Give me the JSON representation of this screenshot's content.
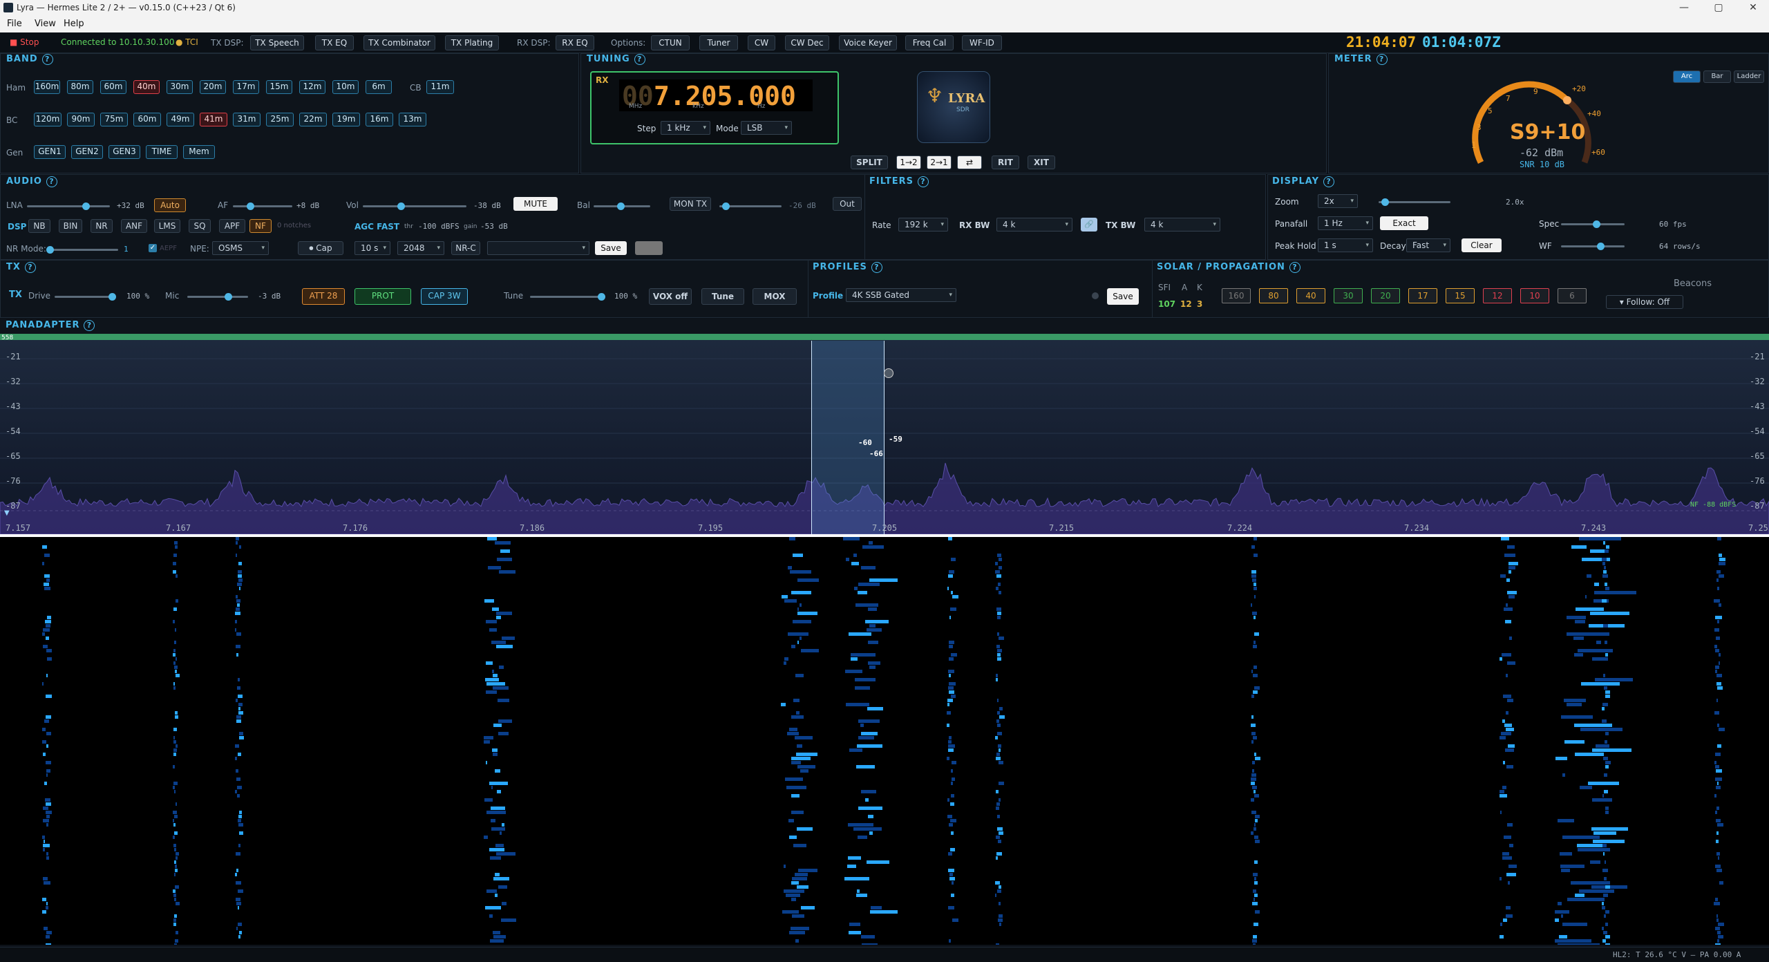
{
  "window": {
    "title": "Lyra — Hermes Lite 2 / 2+ — v0.15.0 (C++23 / Qt 6)",
    "minimize": "—",
    "maximize": "▢",
    "close": "✕"
  },
  "menu": [
    "File",
    "View",
    "Help"
  ],
  "toolbar": {
    "stop": "■ Stop",
    "connected": "Connected to 10.10.30.100",
    "tci": "● TCI",
    "tx_dsp_label": "TX DSP:",
    "tx_buttons": [
      "TX Speech",
      "TX EQ",
      "TX Combinator",
      "TX Plating"
    ],
    "rx_dsp_label": "RX DSP:",
    "rx_eq": "RX EQ",
    "options_label": "Options:",
    "option_buttons": [
      "CTUN",
      "Tuner",
      "CW",
      "CW Dec",
      "Voice Keyer",
      "Freq Cal",
      "WF-ID"
    ],
    "local_time": "21:04:07",
    "utc_time": "01:04:07Z"
  },
  "band": {
    "title": "BAND",
    "help": "?",
    "ham_label": "Ham",
    "ham": [
      "160m",
      "80m",
      "60m",
      "40m",
      "30m",
      "20m",
      "17m",
      "15m",
      "12m",
      "10m",
      "6m"
    ],
    "cb_label": "CB",
    "cb": [
      "11m"
    ],
    "bc_label": "BC",
    "bc": [
      "120m",
      "90m",
      "75m",
      "60m",
      "49m",
      "41m",
      "31m",
      "25m",
      "22m",
      "19m",
      "16m",
      "13m"
    ],
    "gen_label": "Gen",
    "gen": [
      "GEN1",
      "GEN2",
      "GEN3",
      "TIME",
      "Mem"
    ],
    "active_ham": "40m",
    "active_bc": "41m"
  },
  "tuning": {
    "title": "TUNING",
    "help": "?",
    "rx": "RX",
    "freq_dim": "00",
    "freq": "7.205.000",
    "u_mhz": "MHz",
    "u_khz": "kHz",
    "u_hz": "Hz",
    "step_label": "Step",
    "step": "1 kHz",
    "mode_label": "Mode",
    "mode": "LSB",
    "logo_text": "LYRA",
    "logo_sub": "SDR",
    "buttons": [
      "SPLIT",
      "1→2",
      "2→1",
      "⇄",
      "RIT",
      "XIT"
    ]
  },
  "meter": {
    "title": "METER",
    "help": "?",
    "modes": [
      "Arc",
      "Bar",
      "Ladder"
    ],
    "reading": "S9+10",
    "dbm": "-62 dBm",
    "snr": "SNR 10 dB",
    "scale": [
      "1",
      "3",
      "5",
      "7",
      "9",
      "+20",
      "+40",
      "+60"
    ]
  },
  "audio": {
    "title": "AUDIO",
    "help": "?",
    "lna": "LNA",
    "lna_val": "+32 dB",
    "auto": "Auto",
    "af": "AF",
    "af_val": "+8 dB",
    "vol": "Vol",
    "vol_val": "-38 dB",
    "mute": "MUTE",
    "bal": "Bal",
    "mon_tx": "MON TX",
    "mon_val": "-26 dB",
    "out": "Out",
    "dsp": "DSP",
    "dsp_buttons": [
      "NB",
      "BIN",
      "NR",
      "ANF",
      "LMS",
      "SQ",
      "APF",
      "NF"
    ],
    "notches": "0 notches",
    "agc": "AGC FAST",
    "thr": "thr",
    "thr_val": "-100 dBFS",
    "gain": "gain",
    "gain_val": "-53 dB",
    "nr_mode": "NR Mode:",
    "nr_val": "1",
    "aepf": "AEPF",
    "npe": "NPE:",
    "npe_val": "OSMS",
    "cap": "⏺ Cap",
    "cap_time": "10 s",
    "fft": "2048",
    "nrc": "NR-C",
    "save": "Save"
  },
  "filters": {
    "title": "FILTERS",
    "help": "?",
    "rate_label": "Rate",
    "rate": "192 k",
    "rxbw_label": "RX BW",
    "rxbw": "4 k",
    "txbw_label": "TX BW",
    "txbw": "4 k",
    "link": "🔗"
  },
  "display": {
    "title": "DISPLAY",
    "help": "?",
    "zoom_label": "Zoom",
    "zoom": "2x",
    "zoom_val": "2.0x",
    "panafall_label": "Panafall",
    "panafall": "1 Hz",
    "exact": "Exact",
    "peak_label": "Peak Hold",
    "peak": "1 s",
    "decay_label": "Decay",
    "decay": "Fast",
    "clear": "Clear",
    "spec_label": "Spec",
    "spec_val": "60 fps",
    "wf_label": "WF",
    "wf_val": "64 rows/s"
  },
  "tx": {
    "title": "TX",
    "help": "?",
    "tx": "TX",
    "drive": "Drive",
    "drive_val": "100 %",
    "mic": "Mic",
    "mic_val": "-3 dB",
    "att": "ATT 28",
    "prot": "PROT",
    "cap": "CAP 3W",
    "tune_label": "Tune",
    "tune_val": "100 %",
    "vox": "VOX off",
    "tune": "Tune",
    "mox": "MOX"
  },
  "profiles": {
    "title": "PROFILES",
    "help": "?",
    "profile_label": "Profile",
    "profile": "4K SSB Gated",
    "save": "Save"
  },
  "solar": {
    "title": "SOLAR / PROPAGATION",
    "help": "?",
    "sfi_label": "SFI",
    "a_label": "A",
    "k_label": "K",
    "sfi": "107",
    "a": "12",
    "k": "3",
    "bands": [
      {
        "label": "160",
        "color": "#777777"
      },
      {
        "label": "80",
        "color": "#e0a030"
      },
      {
        "label": "40",
        "color": "#e0a030"
      },
      {
        "label": "30",
        "color": "#40b050"
      },
      {
        "label": "20",
        "color": "#40b050"
      },
      {
        "label": "17",
        "color": "#e0a030"
      },
      {
        "label": "15",
        "color": "#e0a030"
      },
      {
        "label": "12",
        "color": "#e04050"
      },
      {
        "label": "10",
        "color": "#e04050"
      },
      {
        "label": "6",
        "color": "#777777"
      }
    ],
    "beacons": "Beacons",
    "follow": "▾ Follow: Off"
  },
  "panadapter": {
    "title": "PANADAPTER",
    "help": "?",
    "db_ticks": [
      "-21",
      "-32",
      "-43",
      "-54",
      "-65",
      "-76",
      "-87"
    ],
    "freq_ticks": [
      "7.157",
      "7.167",
      "7.176",
      "7.186",
      "7.195",
      "7.205",
      "7.215",
      "7.224",
      "7.234",
      "7.243",
      "7.253"
    ],
    "nf": "NF -88 dBFS",
    "peak_labels": [
      "-60",
      "-66",
      "-59"
    ],
    "corner": "558"
  },
  "status": {
    "text": "HL2: T 26.6 °C   V —   PA 0.00 A"
  }
}
